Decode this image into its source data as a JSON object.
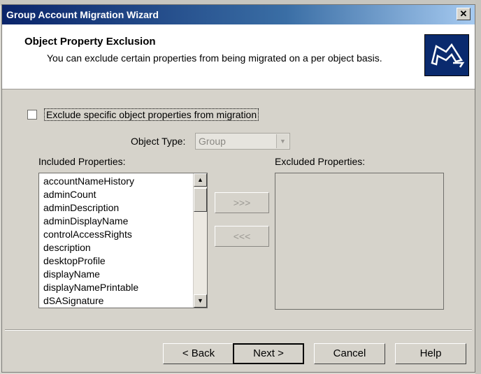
{
  "window": {
    "title": "Group Account Migration Wizard",
    "close_label": "✕"
  },
  "header": {
    "title": "Object Property Exclusion",
    "subtitle": "You can exclude certain properties from being migrated on a per object basis.",
    "logo_icon": "wizard-arrow-icon"
  },
  "exclude_option": {
    "label": "Exclude specific object properties from migration",
    "checked": false
  },
  "object_type": {
    "label": "Object Type:",
    "value": "Group"
  },
  "included": {
    "label": "Included Properties:",
    "items": [
      "accountNameHistory",
      "adminCount",
      "adminDescription",
      "adminDisplayName",
      "controlAccessRights",
      "description",
      "desktopProfile",
      "displayName",
      "displayNamePrintable",
      "dSASignature"
    ]
  },
  "excluded": {
    "label": "Excluded Properties:",
    "items": []
  },
  "move_buttons": {
    "add": ">>>",
    "remove": "<<<"
  },
  "footer": {
    "back": "< Back",
    "next": "Next >",
    "cancel": "Cancel",
    "help": "Help"
  },
  "colors": {
    "title_bar": "#0a246a",
    "dialog_face": "#d6d3cb",
    "logo_bg": "#0a2a6e"
  }
}
